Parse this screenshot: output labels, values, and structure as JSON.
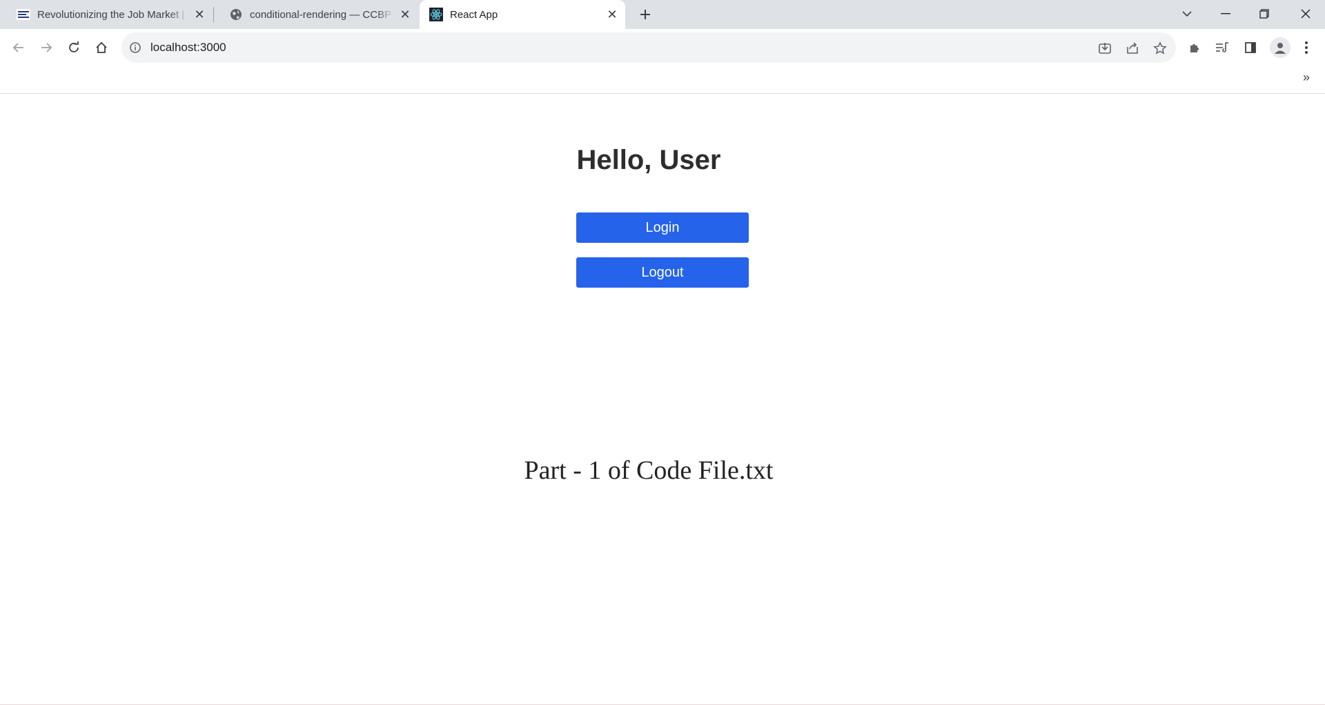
{
  "browser": {
    "tabs": [
      {
        "title": "Revolutionizing the Job Market |",
        "favicon": "nxtwave-favicon"
      },
      {
        "title": "conditional-rendering — CCBP IDE",
        "favicon": "globe-icon"
      },
      {
        "title": "React App",
        "favicon": "react-icon"
      }
    ],
    "address": "localhost:3000"
  },
  "page": {
    "greeting": "Hello, User",
    "login_label": "Login",
    "logout_label": "Logout",
    "caption": "Part - 1 of Code File.txt"
  },
  "colors": {
    "accent": "#2563eb",
    "tabstrip": "#dee1e6"
  }
}
